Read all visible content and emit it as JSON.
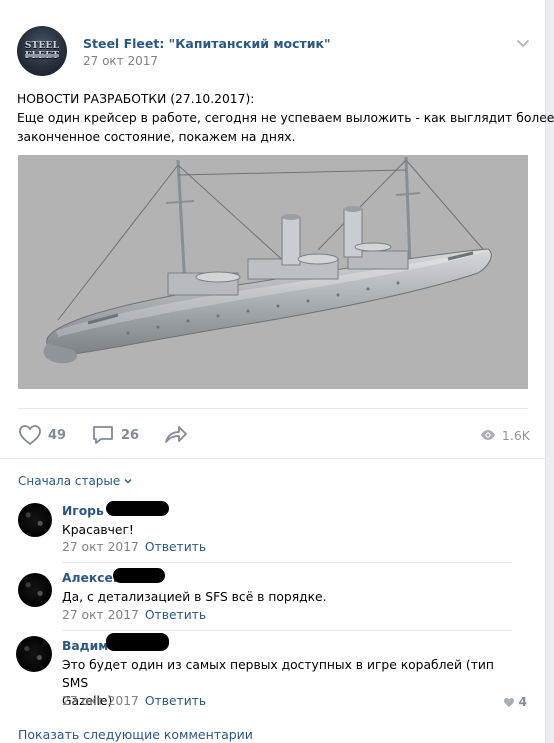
{
  "post": {
    "author": "Steel Fleet: \"Капитанский мостик\"",
    "date": "27 окт 2017",
    "avatar_logo_top": "STEEL FLEET",
    "text_line1": "НОВОСТИ РАЗРАБОТКИ (27.10.2017):",
    "text_line2": "Еще один крейсер в работе, сегодня не успеваем выложить - как выглядит более",
    "text_line3": "законченное состояние, покажем на днях.",
    "image_icon": "cruiser-3d-render",
    "likes": "49",
    "comments": "26",
    "views": "1.6K"
  },
  "comments": {
    "sort_label": "Сначала старые",
    "items": [
      {
        "name": "Игорь",
        "text": "Красавчег!",
        "date": "27 окт 2017",
        "reply": "Ответить"
      },
      {
        "name": "Алексей",
        "text": "Да, с детализацией в SFS всё в порядке.",
        "date": "27 окт 2017",
        "reply": "Ответить"
      },
      {
        "name": "Вадим",
        "text_line1": "Это будет один из самых первых доступных в игре кораблей (тип SMS",
        "text_line2": "Gazelle)",
        "date": "27 окт 2017",
        "reply": "Ответить",
        "likes": "4"
      }
    ],
    "show_more": "Показать следующие комментарии"
  },
  "colors": {
    "link": "#2a5885",
    "muted": "#828282",
    "icon": "#828a99",
    "image_bg": "#b3b3b3"
  }
}
